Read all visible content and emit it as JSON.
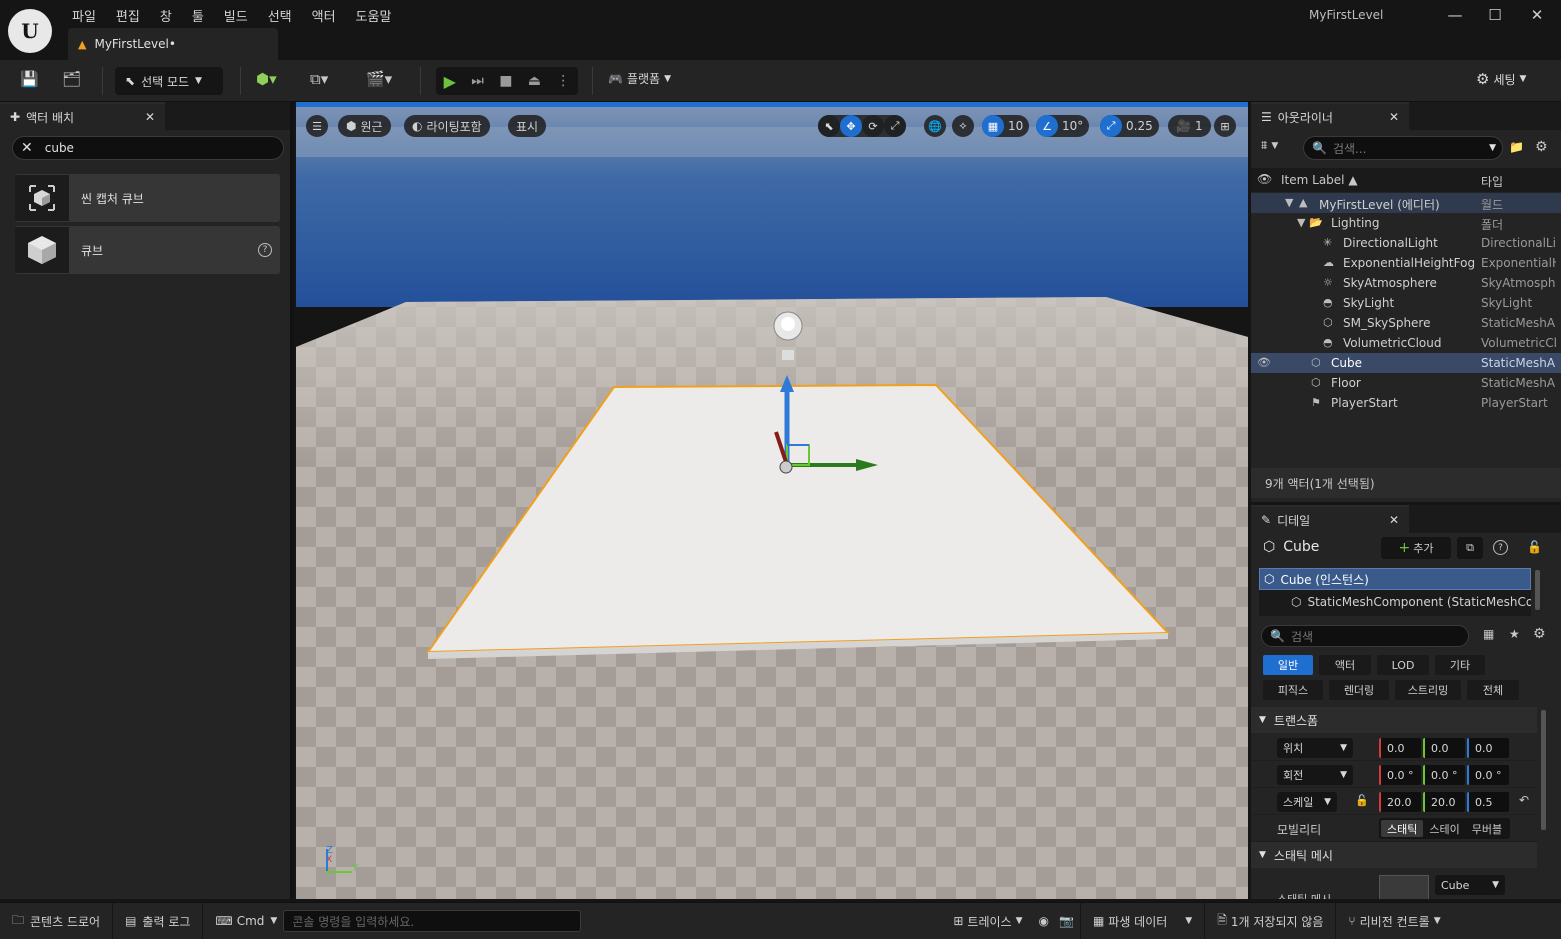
{
  "app": {
    "window_title": "MyFirstLevel",
    "tab_title": "MyFirstLevel•",
    "logo_text": "U"
  },
  "menu": [
    "파일",
    "편집",
    "창",
    "툴",
    "빌드",
    "선택",
    "액터",
    "도움말"
  ],
  "window_controls": {
    "minimize": "—",
    "maximize": "☐",
    "close": "✕"
  },
  "toolbar": {
    "select_mode": "선택 모드",
    "platform": "플랫폼",
    "settings": "세팅"
  },
  "place_actors": {
    "tab_label": "액터 배치",
    "search_value": "cube",
    "items": [
      {
        "label": "씬 캡처 큐브"
      },
      {
        "label": "큐브"
      }
    ]
  },
  "viewport": {
    "perspective": "원근",
    "lighting": "라이팅포함",
    "show": "표시",
    "grid_snap": "10",
    "rotation_snap": "10°",
    "scale_snap": "0.25",
    "camera_speed": "1",
    "axis_z": "Z",
    "axis_y": "Y",
    "axis_x": "X"
  },
  "outliner": {
    "tab_label": "아웃라이너",
    "search_placeholder": "검색...",
    "col_label": "Item Label ▲",
    "col_type": "타입",
    "rows": [
      {
        "label": "MyFirstLevel (에디터)",
        "type": "월드",
        "icon": "level-icon"
      },
      {
        "label": "Lighting",
        "type": "폴더",
        "icon": "folder-icon"
      },
      {
        "label": "DirectionalLight",
        "type": "DirectionalLi",
        "icon": "sun-icon"
      },
      {
        "label": "ExponentialHeightFog",
        "type": "ExponentialH",
        "icon": "fog-icon"
      },
      {
        "label": "SkyAtmosphere",
        "type": "SkyAtmosph",
        "icon": "atmosphere-icon"
      },
      {
        "label": "SkyLight",
        "type": "SkyLight",
        "icon": "skylight-icon"
      },
      {
        "label": "SM_SkySphere",
        "type": "StaticMeshA",
        "icon": "mesh-icon"
      },
      {
        "label": "VolumetricCloud",
        "type": "VolumetricCl",
        "icon": "cloud-icon"
      },
      {
        "label": "Cube",
        "type": "StaticMeshA",
        "icon": "mesh-icon"
      },
      {
        "label": "Floor",
        "type": "StaticMeshA",
        "icon": "mesh-icon"
      },
      {
        "label": "PlayerStart",
        "type": "PlayerStart",
        "icon": "player-start-icon"
      }
    ],
    "status": "9개 액터(1개 선택됨)"
  },
  "details": {
    "tab_label": "디테일",
    "actor_name": "Cube",
    "add_button": "추가",
    "components": [
      "Cube (인스턴스)",
      "StaticMeshComponent (StaticMeshCo"
    ],
    "search_placeholder": "검색",
    "categories_row1": [
      "일반",
      "액터",
      "LOD",
      "기타"
    ],
    "categories_row2": [
      "피직스",
      "렌더링",
      "스트리밍",
      "전체"
    ],
    "transform_section": "트랜스폼",
    "location_label": "위치",
    "location": [
      "0.0",
      "0.0",
      "0.0"
    ],
    "rotation_label": "회전",
    "rotation": [
      "0.0 °",
      "0.0 °",
      "0.0 °"
    ],
    "scale_label": "스케일",
    "scale": [
      "20.0",
      "20.0",
      "0.5"
    ],
    "mobility_label": "모빌리티",
    "mobility_options": [
      "스태틱",
      "스테이",
      "무버블"
    ],
    "static_mesh_section": "스태틱 메시",
    "static_mesh_label": "스태틱 메시",
    "static_mesh_value": "Cube"
  },
  "bottombar": {
    "content_drawer": "콘텐츠 드로어",
    "output_log": "출력 로그",
    "cmd": "Cmd",
    "console_placeholder": "콘솔 명령을 입력하세요.",
    "trace": "트레이스",
    "derived_data": "파생 데이터",
    "unsaved": "1개 저장되지 않음",
    "revision_control": "리비전 컨트롤"
  }
}
